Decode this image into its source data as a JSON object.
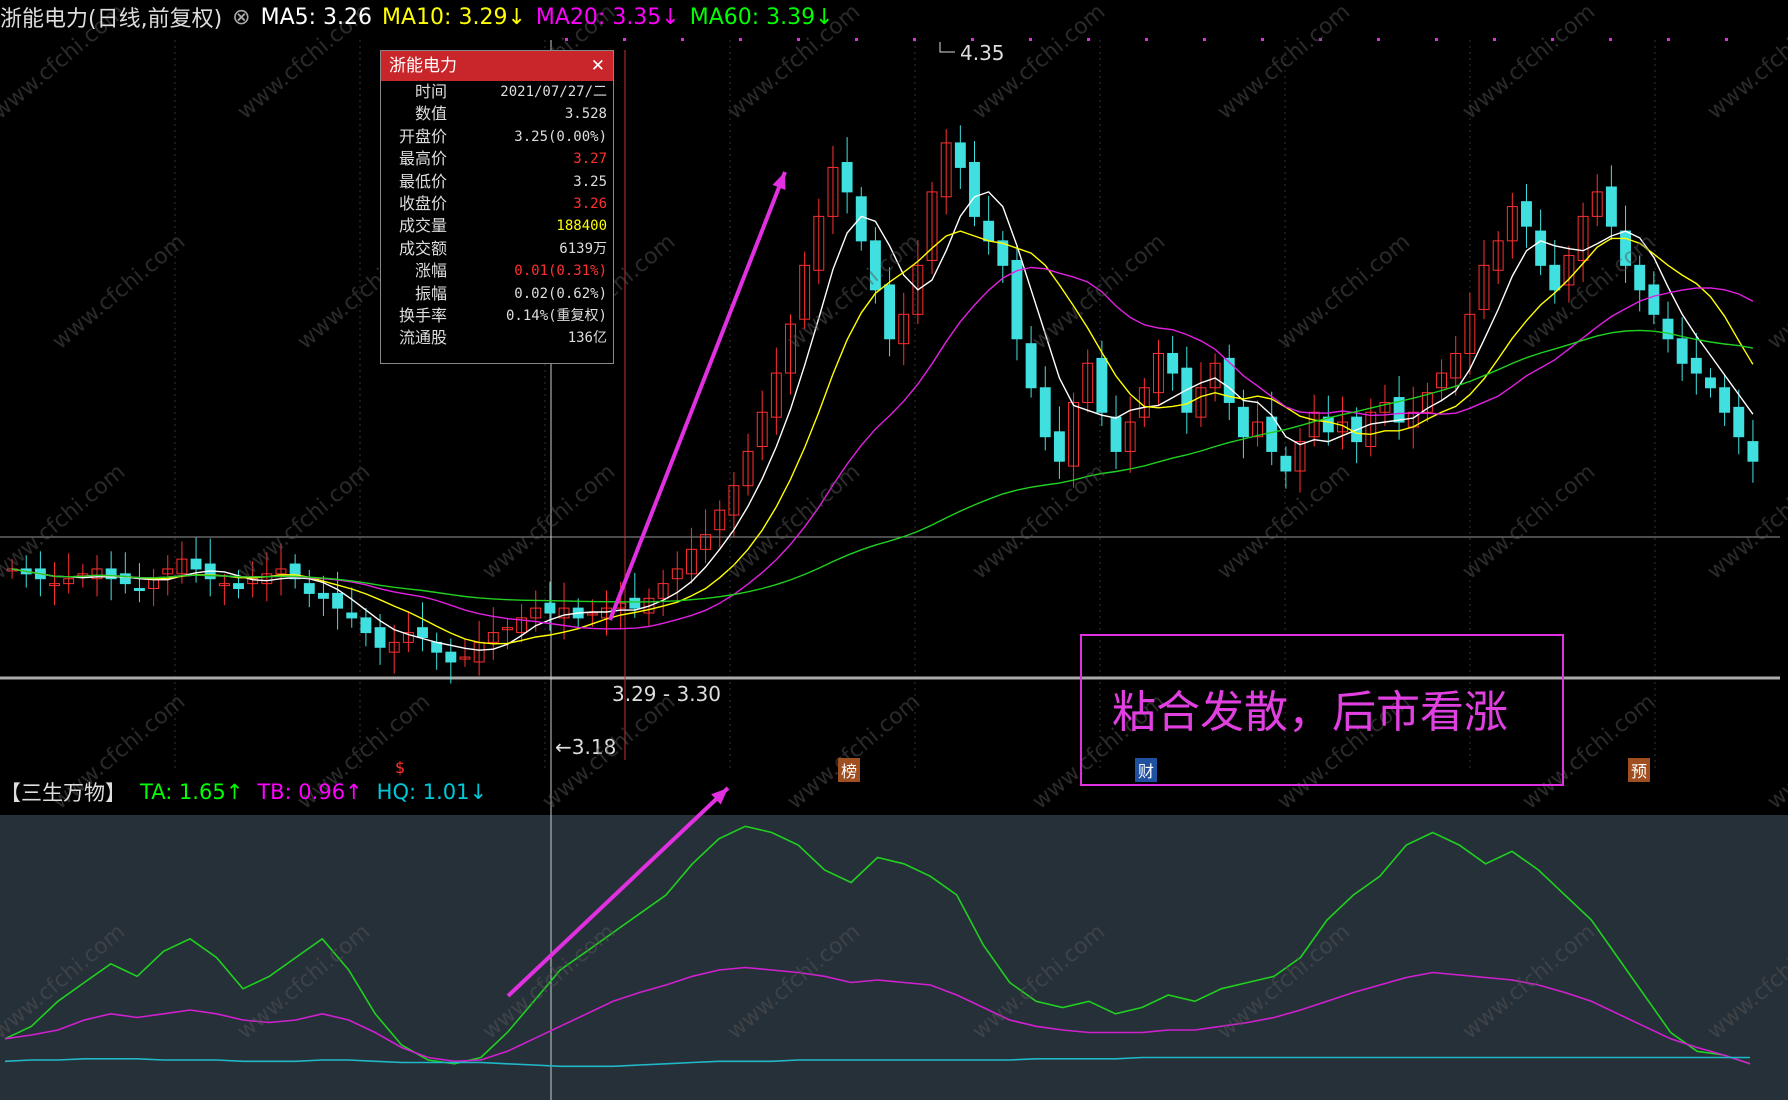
{
  "header": {
    "title": "浙能电力(日线,前复权)",
    "items": [
      {
        "label": "MA5: 3.26",
        "color": "#ffffff"
      },
      {
        "label": "MA10: 3.29↓",
        "color": "#ffff00"
      },
      {
        "label": "MA20: 3.35↓",
        "color": "#ff00ff"
      },
      {
        "label": "MA60: 3.39↓",
        "color": "#00ff00"
      }
    ]
  },
  "tooltip": {
    "title": "浙能电力",
    "close": "✕",
    "rows": [
      {
        "k": "时间",
        "v": "2021/07/27/二",
        "color": "#dddddd"
      },
      {
        "k": "数值",
        "v": "3.528",
        "color": "#dddddd"
      },
      {
        "k": "开盘价",
        "v": "3.25(0.00%)",
        "color": "#dddddd"
      },
      {
        "k": "最高价",
        "v": "3.27",
        "color": "#ff3030"
      },
      {
        "k": "最低价",
        "v": "3.25",
        "color": "#dddddd"
      },
      {
        "k": "收盘价",
        "v": "3.26",
        "color": "#ff3030"
      },
      {
        "k": "成交量",
        "v": "188400",
        "color": "#ffff00"
      },
      {
        "k": "成交额",
        "v": "6139万",
        "color": "#dddddd"
      },
      {
        "k": "涨幅",
        "v": "0.01(0.31%)",
        "color": "#ff3030"
      },
      {
        "k": "振幅",
        "v": "0.02(0.62%)",
        "color": "#dddddd"
      },
      {
        "k": "换手率",
        "v": "0.14%(重复权)",
        "color": "#dddddd"
      },
      {
        "k": "流通股",
        "v": "136亿",
        "color": "#dddddd"
      }
    ]
  },
  "annotations": {
    "high": "4.35",
    "low": "←3.18",
    "range": "3.29 - 3.30",
    "note": "粘合发散，后市看涨",
    "markers": [
      "$",
      "榜",
      "财",
      "预"
    ]
  },
  "sub_header": {
    "title": "【三生万物】",
    "items": [
      {
        "label": "TA: 1.65↑",
        "color": "#00ff00"
      },
      {
        "label": "TB: 0.96↑",
        "color": "#ff00ff"
      },
      {
        "label": "HQ: 1.01↓",
        "color": "#00c8d8"
      }
    ]
  },
  "watermark": "www.cfchi.com",
  "chart_data": [
    {
      "type": "candlestick",
      "title": "浙能电力(日线,前复权)",
      "ylim": [
        3.0,
        4.45
      ],
      "highest": 4.35,
      "lowest": 3.18,
      "series": [
        {
          "name": "K",
          "values": [
            3.38,
            3.37,
            3.36,
            3.35,
            3.36,
            3.37,
            3.38,
            3.36,
            3.35,
            3.34,
            3.36,
            3.38,
            3.4,
            3.38,
            3.36,
            3.35,
            3.34,
            3.36,
            3.37,
            3.38,
            3.36,
            3.33,
            3.32,
            3.3,
            3.28,
            3.25,
            3.22,
            3.23,
            3.25,
            3.24,
            3.21,
            3.19,
            3.2,
            3.23,
            3.25,
            3.26,
            3.28,
            3.3,
            3.29,
            3.3,
            3.28,
            3.29,
            3.3,
            3.31,
            3.3,
            3.32,
            3.35,
            3.38,
            3.42,
            3.45,
            3.5,
            3.55,
            3.62,
            3.7,
            3.78,
            3.88,
            4.0,
            4.1,
            4.2,
            4.15,
            4.05,
            3.95,
            3.85,
            3.9,
            4.0,
            4.15,
            4.25,
            4.2,
            4.1,
            4.05,
            4.0,
            3.85,
            3.75,
            3.65,
            3.6,
            3.72,
            3.8,
            3.7,
            3.62,
            3.68,
            3.75,
            3.82,
            3.78,
            3.7,
            3.75,
            3.8,
            3.72,
            3.65,
            3.68,
            3.62,
            3.58,
            3.64,
            3.7,
            3.66,
            3.68,
            3.64,
            3.7,
            3.72,
            3.68,
            3.7,
            3.74,
            3.78,
            3.82,
            3.9,
            4.0,
            4.05,
            4.12,
            4.08,
            4.0,
            3.95,
            4.02,
            4.1,
            4.15,
            4.08,
            4.0,
            3.95,
            3.9,
            3.85,
            3.8,
            3.78,
            3.75,
            3.7,
            3.65,
            3.6
          ]
        },
        {
          "name": "MA5",
          "values": []
        },
        {
          "name": "MA10",
          "values": []
        },
        {
          "name": "MA20",
          "values": []
        },
        {
          "name": "MA60",
          "values": []
        }
      ]
    },
    {
      "type": "line",
      "title": "【三生万物】",
      "series": [
        {
          "name": "TA",
          "values": [
            0.25,
            0.35,
            0.55,
            0.7,
            0.85,
            0.75,
            0.95,
            1.05,
            0.9,
            0.65,
            0.75,
            0.9,
            1.05,
            0.8,
            0.45,
            0.2,
            0.08,
            0.05,
            0.1,
            0.3,
            0.55,
            0.8,
            0.95,
            1.1,
            1.25,
            1.4,
            1.65,
            1.85,
            1.95,
            1.9,
            1.8,
            1.6,
            1.5,
            1.7,
            1.65,
            1.55,
            1.4,
            1.0,
            0.7,
            0.55,
            0.5,
            0.55,
            0.45,
            0.5,
            0.6,
            0.55,
            0.65,
            0.7,
            0.75,
            0.9,
            1.2,
            1.4,
            1.55,
            1.8,
            1.9,
            1.8,
            1.65,
            1.75,
            1.6,
            1.4,
            1.2,
            0.9,
            0.6,
            0.3,
            0.15,
            0.12,
            0.05
          ]
        },
        {
          "name": "TB",
          "values": [
            0.25,
            0.28,
            0.32,
            0.4,
            0.45,
            0.42,
            0.45,
            0.48,
            0.45,
            0.4,
            0.38,
            0.4,
            0.45,
            0.4,
            0.3,
            0.18,
            0.1,
            0.07,
            0.08,
            0.15,
            0.25,
            0.35,
            0.45,
            0.55,
            0.62,
            0.68,
            0.75,
            0.8,
            0.82,
            0.8,
            0.78,
            0.75,
            0.7,
            0.72,
            0.7,
            0.68,
            0.6,
            0.5,
            0.4,
            0.35,
            0.32,
            0.3,
            0.3,
            0.3,
            0.32,
            0.32,
            0.35,
            0.38,
            0.42,
            0.48,
            0.55,
            0.62,
            0.68,
            0.74,
            0.78,
            0.76,
            0.74,
            0.72,
            0.68,
            0.62,
            0.55,
            0.45,
            0.35,
            0.25,
            0.18,
            0.12,
            0.05
          ]
        },
        {
          "name": "HQ",
          "values": [
            0.07,
            0.08,
            0.08,
            0.09,
            0.09,
            0.09,
            0.08,
            0.08,
            0.08,
            0.07,
            0.07,
            0.07,
            0.08,
            0.08,
            0.07,
            0.06,
            0.06,
            0.06,
            0.06,
            0.05,
            0.04,
            0.03,
            0.03,
            0.03,
            0.04,
            0.05,
            0.06,
            0.07,
            0.07,
            0.07,
            0.08,
            0.08,
            0.08,
            0.08,
            0.08,
            0.08,
            0.08,
            0.08,
            0.08,
            0.09,
            0.09,
            0.09,
            0.09,
            0.1,
            0.1,
            0.1,
            0.1,
            0.1,
            0.1,
            0.1,
            0.1,
            0.1,
            0.1,
            0.1,
            0.1,
            0.1,
            0.1,
            0.1,
            0.1,
            0.1,
            0.1,
            0.1,
            0.1,
            0.1,
            0.1,
            0.1,
            0.1
          ]
        }
      ]
    }
  ]
}
